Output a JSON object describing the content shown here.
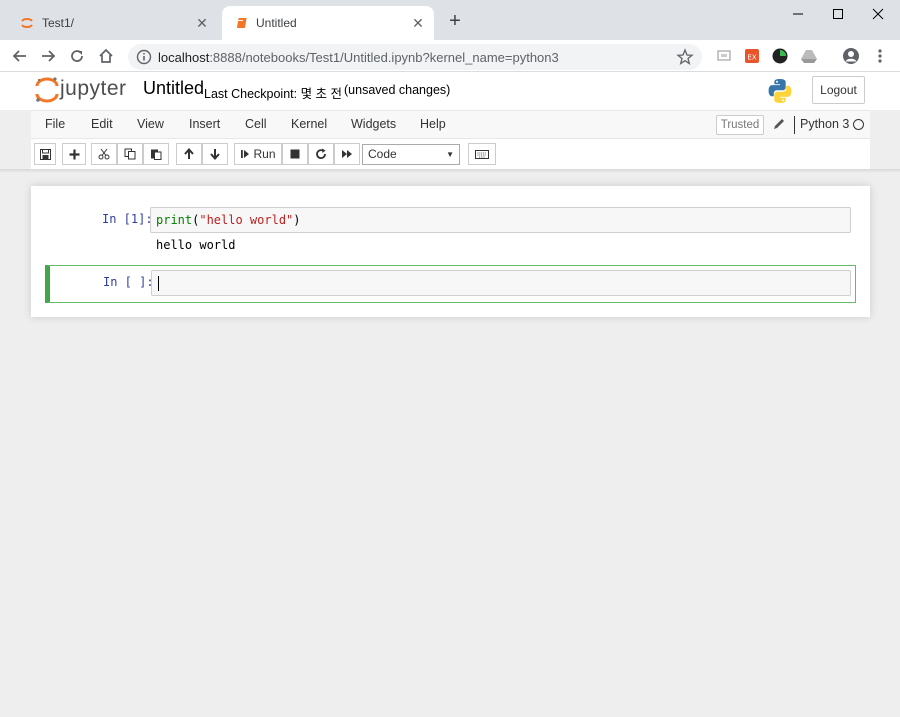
{
  "browser": {
    "tabs": [
      {
        "title": "Test1/",
        "active": false
      },
      {
        "title": "Untitled",
        "active": true
      }
    ],
    "url_host": "localhost",
    "url_rest": ":8888/notebooks/Test1/Untitled.ipynb?kernel_name=python3"
  },
  "header": {
    "logo_text": "jupyter",
    "notebook_name": "Untitled",
    "checkpoint_label": "Last Checkpoint: 몇 초 전",
    "autosave_status": "(unsaved changes)",
    "logout_label": "Logout"
  },
  "menubar": {
    "items": [
      "File",
      "Edit",
      "View",
      "Insert",
      "Cell",
      "Kernel",
      "Widgets",
      "Help"
    ],
    "trusted_label": "Trusted",
    "kernel_name": "Python 3"
  },
  "toolbar": {
    "run_label": "Run",
    "cell_type": "Code"
  },
  "cells": [
    {
      "prompt": "In [1]:",
      "code_func": "print",
      "code_open": "(",
      "code_string": "\"hello world\"",
      "code_close": ")",
      "output": "hello world"
    },
    {
      "prompt": "In [ ]:",
      "code": ""
    }
  ],
  "colors": {
    "accent_orange": "#f37726",
    "selected_cell_border": "#42a548",
    "prompt_blue": "#303f9f"
  }
}
